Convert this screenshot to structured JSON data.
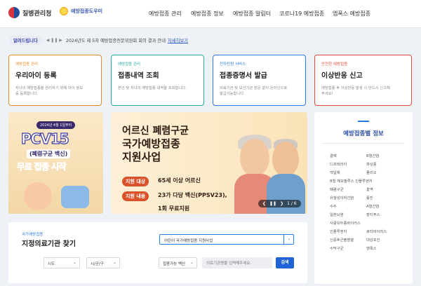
{
  "header": {
    "logo1_text": "질병관리청",
    "logo2_text": "예방접종도우미",
    "nav": [
      "예방접종 관리",
      "예방접종 정보",
      "예방접종 알림터",
      "코로나19 예방접종",
      "엠폭스 예방접종"
    ]
  },
  "notice": {
    "tag": "알려드립니다",
    "ctrl": "◀ ❚❚ ▶",
    "text": "2024년도 제 5차 예방접종전문위원회 회의 결과 안내",
    "more": "자세히보기"
  },
  "cards": [
    {
      "cat": "예방접종 관리",
      "title": "우리아이 등록",
      "desc": "자녀의 예방접종을 관리하기 위해 아이 정보를 등록합니다.",
      "color": "#e58a2e"
    },
    {
      "cat": "예방접종 관리",
      "title": "접종내역 조회",
      "desc": "본인 및 자녀의 예방접종 내역을 조회합니다.",
      "color": "#2aa9a0"
    },
    {
      "cat": "전자민원 서비스",
      "title": "접종증명서 발급",
      "desc": "의료기관 및 보건기관 방문 없이 온라인으로 발급가능합니다.",
      "color": "#2a7be0"
    },
    {
      "cat": "안전한 예방접종",
      "title": "이상반응 신고",
      "desc": "예방접종 후 이상반응 발생 시 반드시 신고해 주세요!",
      "color": "#e04a3a"
    }
  ],
  "banner1": {
    "date": "2024년 4월 1일부터",
    "big": "PCV15",
    "sub": "(폐렴구균 백신)",
    "main": "무료 접종 시작"
  },
  "banner2": {
    "t1": "어르신 폐렴구균",
    "t2": "국가예방접종",
    "t3": "지원사업",
    "row1_label": "지원 대상",
    "row1_value": "65세 이상 어르신",
    "row2_label": "지원 내용",
    "row2_value": "23가 다당 백신(PPSV23),",
    "row2_value2": "1회 무료지원",
    "pager_prev": "❮",
    "pager_pause": "❚❚",
    "pager_next": "❯",
    "pager_count": "1 / 6"
  },
  "side": {
    "title": "예방접종별 정보",
    "vaccines": [
      [
        "결핵",
        "B형간염"
      ],
      [
        "디프테리아",
        "파상풍"
      ],
      [
        "백일해",
        "폴리오"
      ],
      [
        "B형 헤모필루스 인플루엔자",
        ""
      ],
      [
        "폐렴구균",
        "홍역"
      ],
      [
        "유행성이하선염",
        "풍진"
      ],
      [
        "수두",
        "A형간염"
      ],
      [
        "일본뇌염",
        "장티푸스"
      ],
      [
        "사람유두종바이러스",
        ""
      ],
      [
        "인플루엔자",
        "로타바이러스"
      ],
      [
        "신증후군출혈열",
        "대상포진"
      ],
      [
        "수막구균",
        "엠폭스"
      ]
    ]
  },
  "find": {
    "cat": "국가예방접종",
    "title": "지정의료기관 찾기",
    "select": "어린이 국가예방접종 지원사업",
    "dd1": "시도",
    "dd2": "시/군/구",
    "dd3": "접종가능 백신",
    "search_placeholder": "의료기관명을 입력해주세요.",
    "button": "검색"
  }
}
